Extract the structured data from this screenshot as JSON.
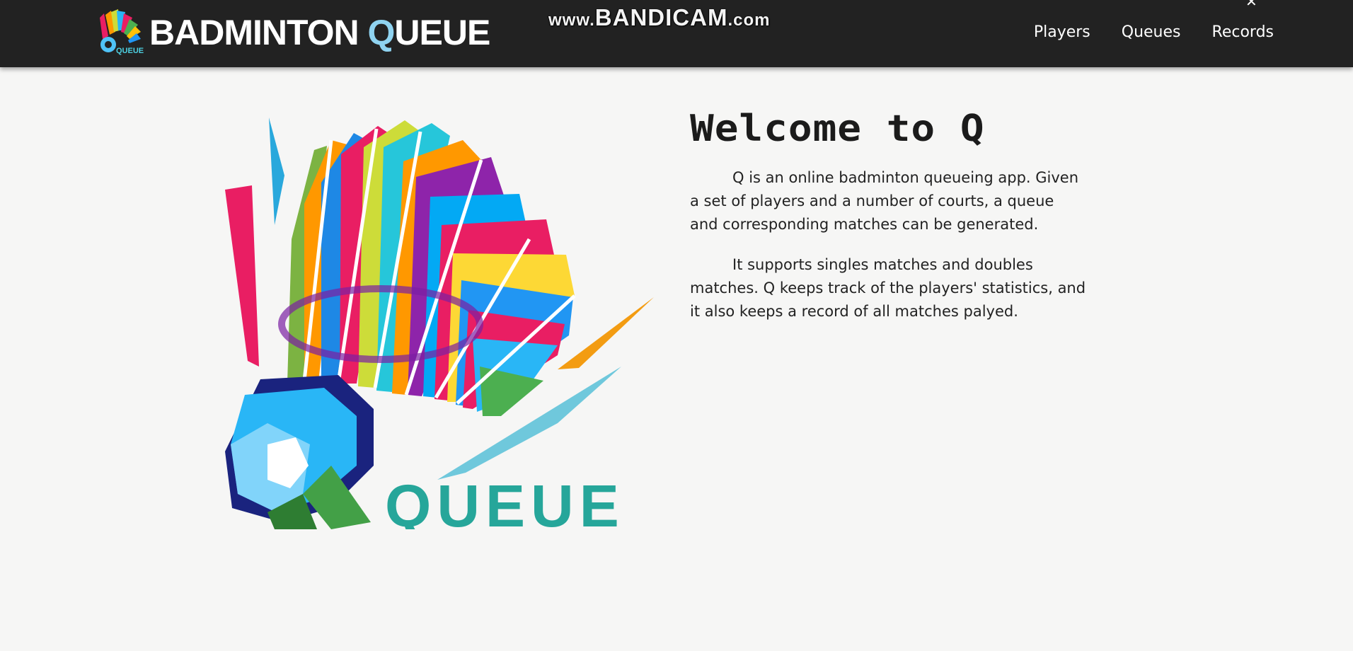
{
  "brand": {
    "title_prefix": "BADMINTON ",
    "title_q": "Q",
    "title_suffix": "UEUE",
    "logo_text": "QUEUE"
  },
  "watermark": {
    "prefix": "www.",
    "main": "BANDICAM",
    "suffix": ".com"
  },
  "nav": {
    "items": [
      "Players",
      "Queues",
      "Records"
    ]
  },
  "hero": {
    "logo_word": "QUEUE"
  },
  "welcome": {
    "heading": "Welcome to Q",
    "paragraphs": [
      "Q is an online badminton queueing app. Given a set of players and a number of courts, a queue and corresponding matches can be generated.",
      "It supports singles matches and doubles matches. Q keeps track of the players' statistics, and it also keeps a record of all matches palyed."
    ]
  },
  "colors": {
    "navbar": "#222222",
    "accent_q": "#8fd3f0",
    "page_bg": "#f6f6f5"
  }
}
